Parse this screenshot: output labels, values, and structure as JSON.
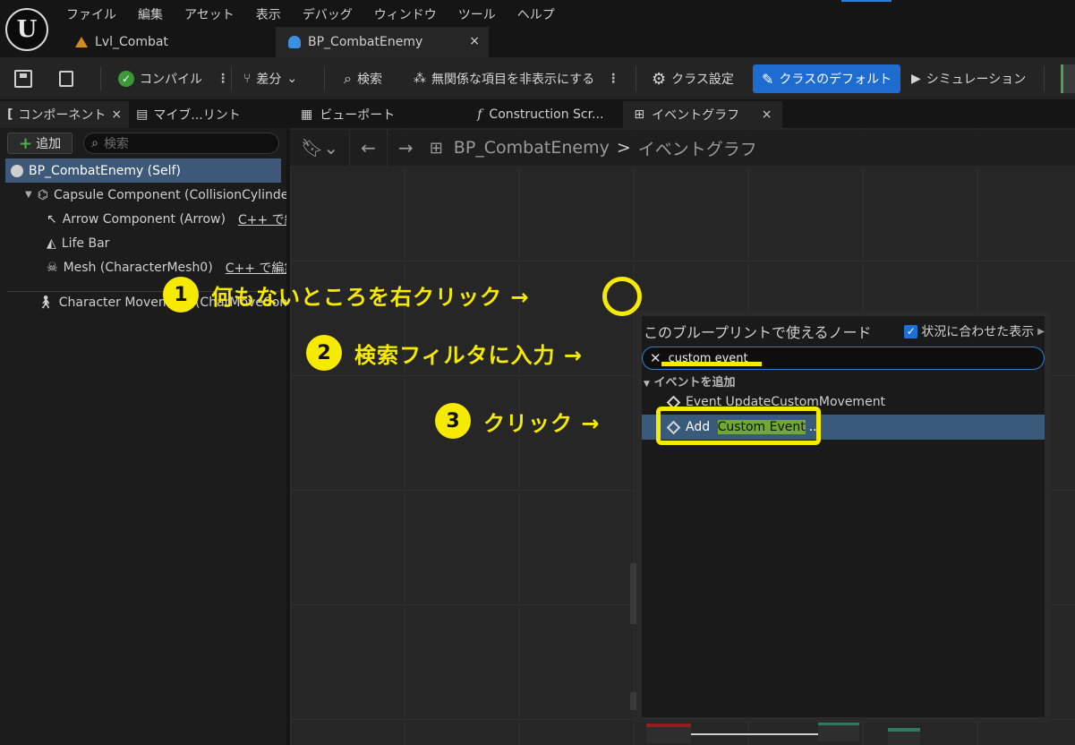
{
  "menu": [
    "ファイル",
    "編集",
    "アセット",
    "表示",
    "デバッグ",
    "ウィンドウ",
    "ツール",
    "ヘルプ"
  ],
  "logo_text": "U",
  "doc_tabs": [
    {
      "label": "Lvl_Combat",
      "icon": "level-icon"
    },
    {
      "label": "BP_CombatEnemy",
      "icon": "blueprint-icon",
      "close": "×"
    }
  ],
  "toolbar": {
    "compile": "コンパイル",
    "diff": "差分",
    "find": "検索",
    "hide_unrelated": "無関係な項目を非表示にする",
    "class_settings": "クラス設定",
    "class_defaults": "クラスのデフォルト",
    "simulation": "シミュレーション",
    "kebab": "⋮",
    "caret": "⌄"
  },
  "left_tabs": {
    "components": "コンポーネント",
    "components_close": "×",
    "my_blueprint": "マイブ...リント"
  },
  "components": {
    "add_label": "追加",
    "search_placeholder": "検索",
    "tree": [
      {
        "label": "BP_CombatEnemy (Self)"
      },
      {
        "label": "Capsule Component (CollisionCylinder)"
      },
      {
        "label": "Arrow Component (Arrow)",
        "cpp": "C++ で編集"
      },
      {
        "label": "Life Bar"
      },
      {
        "label": "Mesh (CharacterMesh0)",
        "cpp": "C++ で編集"
      },
      {
        "label": "Character Movement (CharMoveComp)"
      }
    ]
  },
  "graph_tabs": [
    {
      "label": "ビューポート"
    },
    {
      "label": "Construction Scr..."
    },
    {
      "label": "イベントグラフ",
      "close": "×"
    }
  ],
  "breadcrumb": {
    "blueprint": "BP_CombatEnemy",
    "separator": ">",
    "graph": "イベントグラフ"
  },
  "context_menu": {
    "title": "このブループリントで使えるノード",
    "context_sensitive": "状況に合わせた表示",
    "checkmark": "✓",
    "search_value": "custom event",
    "category": "イベントを追加",
    "items": [
      {
        "label": "Event UpdateCustomMovement"
      },
      {
        "prefix": "Add ",
        "highlight": "Custom Event",
        "suffix": "..."
      }
    ]
  },
  "annotations": [
    {
      "num": "1",
      "text": "何もないところを右クリック →"
    },
    {
      "num": "2",
      "text": "検索フィルタに入力 →"
    },
    {
      "num": "3",
      "text": "クリック →"
    }
  ],
  "colors": {
    "annotation": "#f6ea00",
    "accent": "#1e6cd0",
    "selection": "#3a5a7c",
    "match_highlight": "#6fa832"
  }
}
